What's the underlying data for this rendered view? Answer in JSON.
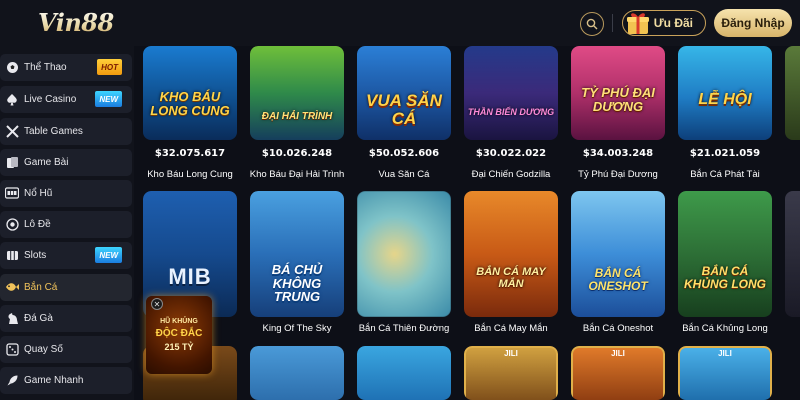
{
  "header": {
    "logo": "Vin88",
    "promo_label": "Ưu Đãi",
    "login_label": "Đăng Nhập"
  },
  "sidebar": {
    "items": [
      {
        "label": "Thể Thao",
        "icon": "soccer-ball-icon",
        "badge": "HOT"
      },
      {
        "label": "Live Casino",
        "icon": "spade-icon",
        "badge": "NEW"
      },
      {
        "label": "Table Games",
        "icon": "crossed-cues-icon",
        "badge": ""
      },
      {
        "label": "Game Bài",
        "icon": "cards-icon",
        "badge": ""
      },
      {
        "label": "Nổ Hũ",
        "icon": "slot-machine-icon",
        "badge": ""
      },
      {
        "label": "Lô Đề",
        "icon": "lottery-ball-icon",
        "badge": ""
      },
      {
        "label": "Slots",
        "icon": "slot-reels-icon",
        "badge": "NEW"
      },
      {
        "label": "Bắn Cá",
        "icon": "fish-icon",
        "badge": "",
        "active": true
      },
      {
        "label": "Đá Gà",
        "icon": "rooster-icon",
        "badge": ""
      },
      {
        "label": "Quay Số",
        "icon": "dice-icon",
        "badge": ""
      },
      {
        "label": "Game Nhanh",
        "icon": "rocket-icon",
        "badge": ""
      }
    ]
  },
  "floating_promo": {
    "line1": "HŨ KHỦNG",
    "line2": "ĐỘC ĐẮC",
    "line3": "215 TỶ"
  },
  "games_row1": [
    {
      "name": "Kho Báu Long Cung",
      "jackpot": "$32.075.617",
      "art": "KHO BÁU LONG CUNG"
    },
    {
      "name": "Kho Báu Đại Hải Trình",
      "jackpot": "$10.026.248",
      "art": "ĐẠI HẢI TRÌNH"
    },
    {
      "name": "Vua Săn Cá",
      "jackpot": "$50.052.606",
      "art": "VUA SĂN CÁ"
    },
    {
      "name": "Đại Chiến Godzilla",
      "jackpot": "$30.022.022",
      "art": "THẦN BIỂN DƯƠNG"
    },
    {
      "name": "Tỷ Phú Đại Dương",
      "jackpot": "$34.003.248",
      "art": "TỶ PHÚ ĐẠI DƯƠNG"
    },
    {
      "name": "Bắn Cá Phát Tài",
      "jackpot": "$21.021.059",
      "art": "LỄ HỘI"
    }
  ],
  "games_row2": [
    {
      "name": "",
      "art": "MIB"
    },
    {
      "name": "King Of The Sky",
      "art": "BÁ CHỦ KHÔNG TRUNG"
    },
    {
      "name": "Bắn Cá Thiên Đường",
      "art": ""
    },
    {
      "name": "Bắn Cá May Mắn",
      "art": "BẮN CÁ MAY MẮN"
    },
    {
      "name": "Bắn Cá Oneshot",
      "art": "BẮN CÁ ONESHOT"
    },
    {
      "name": "Bắn Cá Khủng Long",
      "art": "BẮN CÁ KHỦNG LONG"
    }
  ],
  "games_row3": [
    {
      "art": ""
    },
    {
      "art": ""
    },
    {
      "art": ""
    },
    {
      "art": "JILI"
    },
    {
      "art": "JILI"
    },
    {
      "art": "JILI"
    }
  ]
}
